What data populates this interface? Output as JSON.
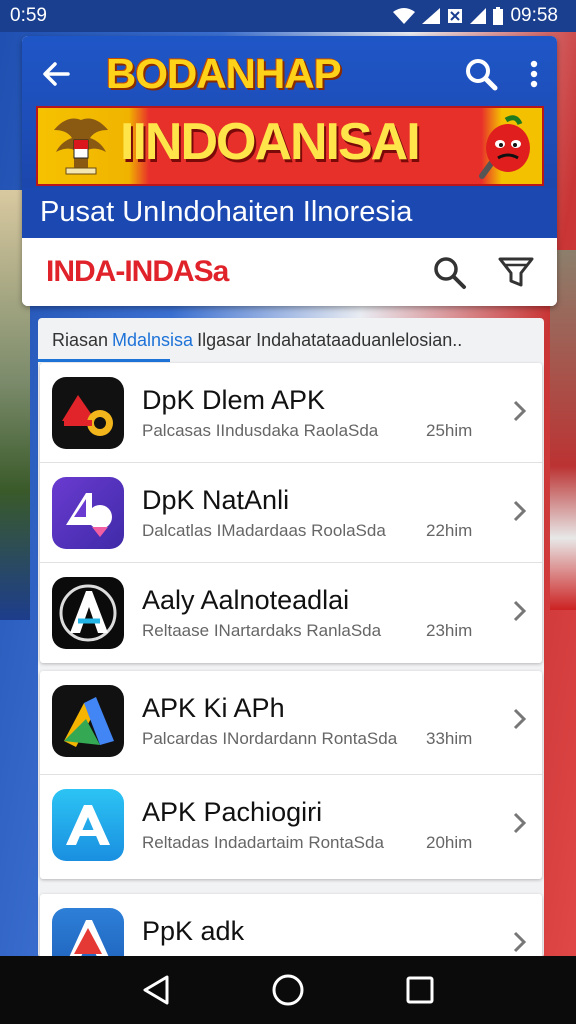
{
  "status_bar": {
    "time_left": "0:59",
    "time_right": "09:58"
  },
  "app_bar": {
    "brand_title": "BODANHAP",
    "banner_text": "IINDOANISAI",
    "subtitle": "Pusat UnIndohaiten Ilnoresia"
  },
  "search": {
    "label": "INDA-INDASa"
  },
  "tabs": {
    "first": "Riasan",
    "active": "Mdalnsisa",
    "rest": "Ilgasar Indahatataaduanlelosian.."
  },
  "apps": [
    {
      "name": "DpK Dlem APK",
      "desc": "Palcasas IIndusdaka RaolaSda",
      "meta": "25him",
      "icon": "record-camera-icon"
    },
    {
      "name": "DpK NatAnli",
      "desc": "Dalcatlas IMadardaas RoolaSda",
      "meta": "22him",
      "icon": "apk-pin-icon"
    },
    {
      "name": "Aaly Aalnoteadlai",
      "desc": "Reltaase INartardaks RanlaSda",
      "meta": "23him",
      "icon": "letter-a-icon"
    },
    {
      "name": "APK Ki APh",
      "desc": "Palcardas INordardann RontaSda",
      "meta": "33him",
      "icon": "google-ads-icon"
    },
    {
      "name": "APK Pachiogiri",
      "desc": "Reltadas Indadartaim RontaSda",
      "meta": "20him",
      "icon": "app-store-icon"
    },
    {
      "name": "PpK adk",
      "desc": "",
      "meta": "",
      "icon": "stacked-a-icon"
    }
  ]
}
